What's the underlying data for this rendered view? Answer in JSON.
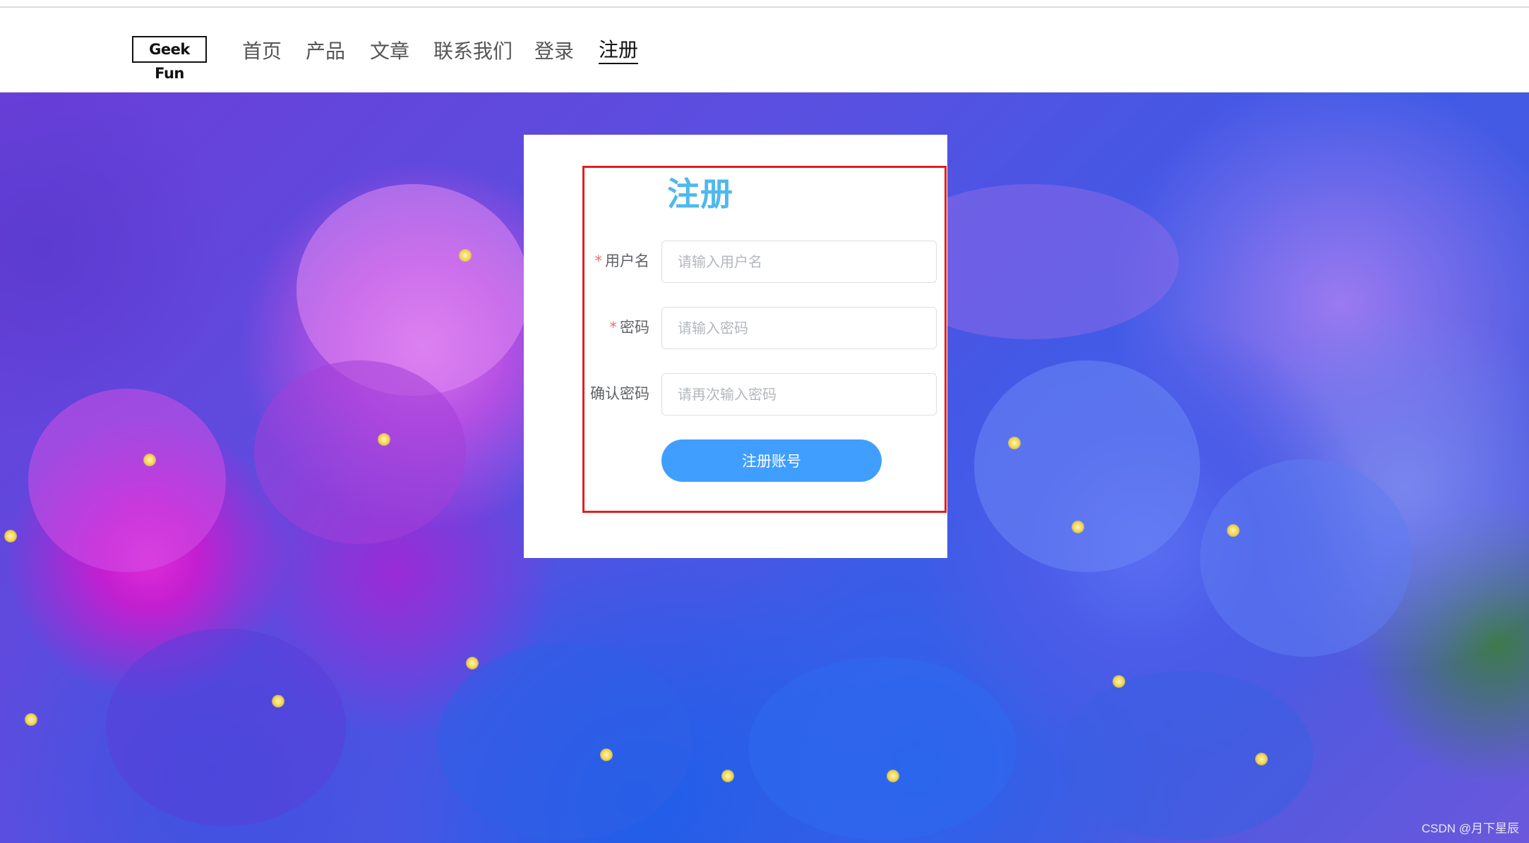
{
  "nav": {
    "logo": "Geek Fun",
    "items": [
      {
        "label": "首页"
      },
      {
        "label": "产品"
      },
      {
        "label": "文章"
      },
      {
        "label": "联系我们"
      },
      {
        "label": "登录"
      },
      {
        "label": "注册",
        "active": true
      }
    ]
  },
  "form": {
    "title": "注册",
    "required_mark": "*",
    "fields": [
      {
        "label": "用户名",
        "required": true,
        "placeholder": "请输入用户名",
        "value": ""
      },
      {
        "label": "密码",
        "required": true,
        "placeholder": "请输入密码",
        "value": ""
      },
      {
        "label": "确认密码",
        "required": false,
        "placeholder": "请再次输入密码",
        "value": ""
      }
    ],
    "submit_label": "注册账号"
  },
  "watermark": "CSDN @月下星辰",
  "colors": {
    "title": "#4fb8ec",
    "button": "#409eff",
    "highlight_border": "#e0201f",
    "required": "#f56c6c"
  }
}
